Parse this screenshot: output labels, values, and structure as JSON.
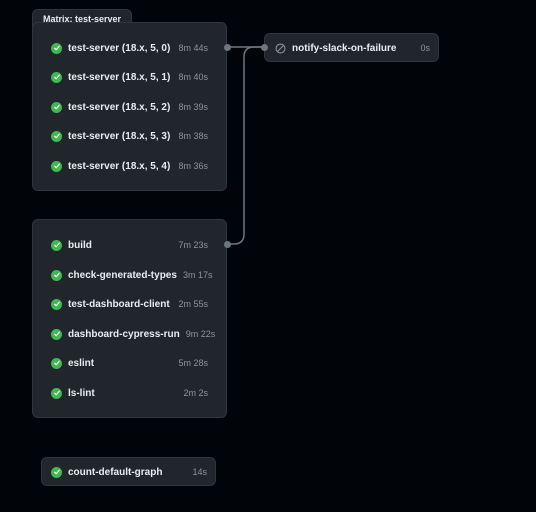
{
  "matrix_group": {
    "label": "Matrix: test-server",
    "jobs": [
      {
        "name": "test-server (18.x, 5, 0)",
        "duration": "8m 44s",
        "status": "success"
      },
      {
        "name": "test-server (18.x, 5, 1)",
        "duration": "8m 40s",
        "status": "success"
      },
      {
        "name": "test-server (18.x, 5, 2)",
        "duration": "8m 39s",
        "status": "success"
      },
      {
        "name": "test-server (18.x, 5, 3)",
        "duration": "8m 38s",
        "status": "success"
      },
      {
        "name": "test-server (18.x, 5, 4)",
        "duration": "8m 36s",
        "status": "success"
      }
    ]
  },
  "build_group": {
    "jobs": [
      {
        "name": "build",
        "duration": "7m 23s",
        "status": "success"
      },
      {
        "name": "check-generated-types",
        "duration": "3m 17s",
        "status": "success"
      },
      {
        "name": "test-dashboard-client",
        "duration": "2m 55s",
        "status": "success"
      },
      {
        "name": "dashboard-cypress-run",
        "duration": "9m 22s",
        "status": "success"
      },
      {
        "name": "eslint",
        "duration": "5m 28s",
        "status": "success"
      },
      {
        "name": "ls-lint",
        "duration": "2m 2s",
        "status": "success"
      }
    ]
  },
  "notify_job": {
    "name": "notify-slack-on-failure",
    "duration": "0s",
    "status": "skipped"
  },
  "standalone_job": {
    "name": "count-default-graph",
    "duration": "14s",
    "status": "success"
  },
  "colors": {
    "background": "#010409",
    "card": "#21262d",
    "border": "#30363d",
    "success": "#3fb950",
    "edge": "#6e7681",
    "muted_text": "#8b949e"
  }
}
